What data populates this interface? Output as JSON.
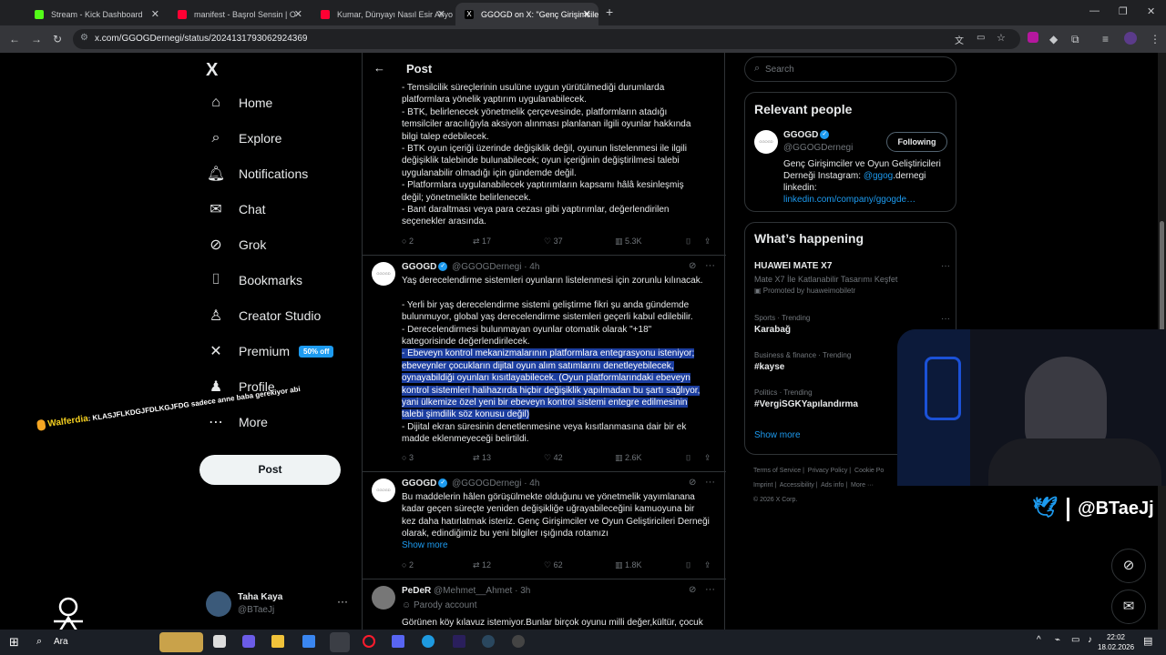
{
  "browser": {
    "tabs": [
      {
        "label": "Stream - Kick Dashboard",
        "color": "#53fc18"
      },
      {
        "label": "manifest - Başrol Sensin | O",
        "color": "#ff0033"
      },
      {
        "label": "Kumar, Dünyayı Nasıl Esir Alıyo",
        "color": "#ff0033"
      },
      {
        "label": "GGOGD on X: \"Genç Girişimcile",
        "color": "#ffffff"
      }
    ],
    "new_tab": "+",
    "url": "x.com/GGOGDernegi/status/2024131793062924369"
  },
  "nav": {
    "logo": "X",
    "items": [
      {
        "label": "Home",
        "icon": "home-icon",
        "glyph": "⌂"
      },
      {
        "label": "Explore",
        "icon": "search-icon",
        "glyph": "⌕"
      },
      {
        "label": "Notifications",
        "icon": "bell-icon",
        "glyph": "🔔︎"
      },
      {
        "label": "Chat",
        "icon": "mail-icon",
        "glyph": "✉"
      },
      {
        "label": "Grok",
        "icon": "grok-icon",
        "glyph": "⊘"
      },
      {
        "label": "Bookmarks",
        "icon": "bookmark-icon",
        "glyph": "⌷"
      },
      {
        "label": "Creator Studio",
        "icon": "creator-icon",
        "glyph": "♙"
      },
      {
        "label": "Premium",
        "icon": "x-premium-icon",
        "glyph": "✕",
        "badge": "50% off"
      },
      {
        "label": "Profile",
        "icon": "person-icon",
        "glyph": "♟"
      },
      {
        "label": "More",
        "icon": "more-icon",
        "glyph": "⋯"
      }
    ],
    "post_button": "Post",
    "account": {
      "name": "Taha Kaya",
      "handle": "@BTaeJj"
    }
  },
  "header": {
    "title": "Post",
    "back": "←"
  },
  "post_top": {
    "lines": [
      "- Temsilcilik süreçlerinin usulüne uygun yürütülmediği durumlarda",
      "platformlara yönelik yaptırım uygulanabilecek.",
      "- BTK, belirlenecek yönetmelik çerçevesinde, platformların atadığı",
      "temsilciler aracılığıyla aksiyon alınması planlanan ilgili oyunlar hakkında",
      "bilgi talep edebilecek.",
      "- BTK oyun içeriği üzerinde değişiklik değil, oyunun listelenmesi ile ilgili",
      "değişiklik talebinde bulunabilecek; oyun içeriğinin değiştirilmesi talebi",
      "uygulanabilir olmadığı için gündemde değil.",
      "- Platformlara uygulanabilecek yaptırımların kapsamı hâlâ kesinleşmiş",
      "değil; yönetmelikte belirlenecek.",
      "- Bant daraltması veya para cezası gibi yaptırımlar, değerlendirilen",
      "seçenekler arasında."
    ],
    "stats": {
      "replies": "2",
      "reposts": "17",
      "likes": "37",
      "views": "5.3K"
    }
  },
  "reply1": {
    "name": "GGOGD",
    "handle": "@GGOGDernegi",
    "time": "· 4h",
    "avatar_text": "GGOGD",
    "lines_plain": [
      "Yaş derecelendirme sistemleri oyunların listelenmesi için zorunlu kılınacak.",
      "",
      "- Yerli bir yaş derecelendirme sistemi geliştirme fikri şu anda gündemde",
      "bulunmuyor, global yaş derecelendirme sistemleri geçerli kabul edilebilir.",
      "- Derecelendirmesi bulunmayan oyunlar otomatik olarak \"+18\"",
      "kategorisinde değerlendirilecek."
    ],
    "lines_highlight": [
      "- Ebeveyn kontrol mekanizmalarının platformlara entegrasyonu isteniyor;",
      "ebeveynler çocukların dijital oyun alım satımlarını denetleyebilecek,",
      "oynayabildiği oyunları kısıtlayabilecek. (Oyun platformlarındaki ebeveyn",
      "kontrol sistemleri halihazırda hiçbir değişiklik yapılmadan bu şartı sağlıyor,",
      "yani ülkemize özel yeni bir ebeveyn kontrol sistemi entegre edilmesinin",
      "talebi şimdilik söz konusu değil)"
    ],
    "lines_end": [
      "- Dijital ekran süresinin denetlenmesine veya kısıtlanmasına dair bir ek",
      "madde eklenmeyeceği belirtildi."
    ],
    "stats": {
      "replies": "3",
      "reposts": "13",
      "likes": "42",
      "views": "2.6K"
    }
  },
  "reply2": {
    "name": "GGOGD",
    "handle": "@GGOGDernegi",
    "time": "· 4h",
    "avatar_text": "GGOGD",
    "lines": [
      "Bu maddelerin hâlen görüşülmekte olduğunu ve yönetmelik yayımlanana",
      "kadar geçen süreçte yeniden değişikliğe uğrayabileceğini kamuoyuna bir",
      "kez daha hatırlatmak isteriz. Genç Girişimciler ve Oyun Geliştiricileri Derneği",
      "olarak, edindiğimiz bu yeni bilgiler ışığında rotamızı"
    ],
    "show_more": "Show more",
    "stats": {
      "replies": "2",
      "reposts": "12",
      "likes": "62",
      "views": "1.8K"
    }
  },
  "reply3": {
    "name": "PeDeR",
    "handle": "@Mehmet__Ahmet",
    "time": "· 3h",
    "parody": "Parody account",
    "lines": [
      "Görünen köy kılavuz istemiyor.Bunlar birçok oyunu milli değer,kültür, çocuk"
    ]
  },
  "search": {
    "placeholder": "Search"
  },
  "relevant": {
    "title": "Relevant people",
    "name": "GGOGD",
    "handle": "@GGOGDernegi",
    "follow_label": "Following",
    "bio1": "Genç Girişimciler ve Oyun Geliştiricileri",
    "bio2a": "Derneği Instagram: ",
    "bio2b": "@ggog",
    "bio2c": ".dernegi",
    "bio3": "linkedin:",
    "link": "linkedin.com/company/ggogde…"
  },
  "happening": {
    "title": "What’s happening",
    "items": [
      {
        "cat": "",
        "name": "HUAWEI MATE X7",
        "sub": "Mate X7 İle Katlanabilir Tasarımı Keşfet",
        "promo": "Promoted by huaweimobiletr"
      },
      {
        "cat": "Sports · Trending",
        "name": "Karabağ"
      },
      {
        "cat": "Business & finance · Trending",
        "name": "#kayse"
      },
      {
        "cat": "Politics · Trending",
        "name": "#VergiSGKYapılandırma"
      }
    ],
    "show_more": "Show more"
  },
  "footer": {
    "links": [
      "Terms of Service",
      "Privacy Policy",
      "Cookie Po",
      "Imprint",
      "Accessibility",
      "Ads info",
      "More ···"
    ],
    "copyright": "© 2026 X Corp."
  },
  "overlay": {
    "chat_user": "Walferdia",
    "chat_msg": ": KLASJFLKDGJFDLKGJFDG sadece anne baba gerekiyor abi",
    "handle": "@BTaeJj"
  },
  "taskbar": {
    "search": "Ara",
    "time": "22:02",
    "date": "18.02.2026"
  },
  "colors": {
    "accent": "#1d9bf0",
    "selection": "#1c3ea0",
    "muted": "#71767b",
    "border": "#2f3336"
  }
}
